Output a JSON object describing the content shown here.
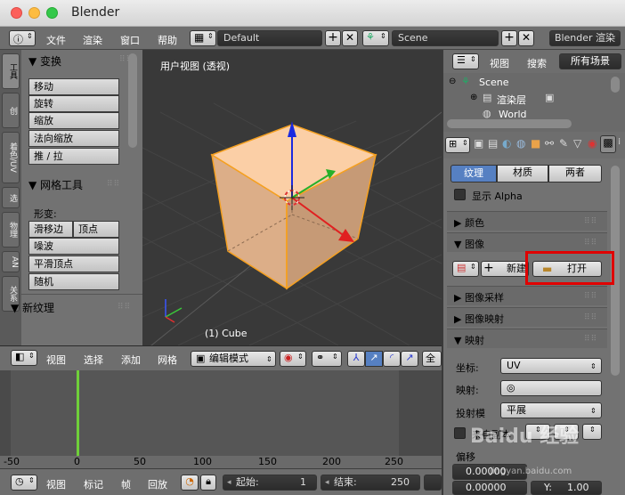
{
  "window": {
    "title": "Blender"
  },
  "topbar": {
    "menus": [
      "文件",
      "渲染",
      "窗口",
      "帮助"
    ],
    "screen_layout": "Default",
    "scene": "Scene",
    "render_engine": "Blender 渲染"
  },
  "left_tabs": [
    "工具",
    "创",
    "着色/UV",
    "选",
    "物理",
    "AN",
    "关系"
  ],
  "toolshelf": {
    "transform_title": "▼ 变换",
    "transform_items": [
      "移动",
      "旋转",
      "缩放",
      "法向缩放",
      "推 / 拉"
    ],
    "mesh_tools_title": "▼ 网格工具",
    "deform_label": "形变:",
    "slide_edge": "滑移边",
    "vertex": "顶点",
    "mesh_items": [
      "噪波",
      "平滑顶点",
      "随机"
    ],
    "new_texture_title": "▼ 新纹理"
  },
  "viewport": {
    "label": "用户视图 (透视)",
    "object_label": "(1) Cube"
  },
  "viewport_header": {
    "menus": [
      "视图",
      "选择",
      "添加",
      "网格"
    ],
    "mode": "编辑模式",
    "global": "全局"
  },
  "timeline": {
    "ruler_labels": [
      "-50",
      "0",
      "50",
      "100",
      "150",
      "200",
      "250"
    ]
  },
  "bottombar": {
    "menus": [
      "视图",
      "标记",
      "帧",
      "回放"
    ],
    "start_label": "起始:",
    "start_value": "1",
    "end_label": "结束:",
    "end_value": "250"
  },
  "outliner_header": {
    "view": "视图",
    "search": "搜索",
    "scope": "所有场景"
  },
  "outliner": {
    "items": [
      "Scene",
      "渲染层",
      "World"
    ]
  },
  "texture_props": {
    "tabs": [
      "纹理",
      "材质",
      "两者"
    ],
    "show_alpha": "显示 Alpha",
    "panel_color": "▶ 颜色",
    "panel_image": "▼ 图像",
    "new_label": "新建",
    "open_label": "打开",
    "panel_sampling": "▶ 图像采样",
    "panel_mapping": "▶ 图像映射",
    "panel_map": "▼ 映射",
    "coords_label": "坐标:",
    "coords_value": "UV",
    "map_label": "映射:",
    "projection_label": "投射模",
    "projection_value": "平展",
    "from_dupli": "来自副本",
    "offset_label": "偏移",
    "offset_x": "0.00000",
    "offset_y": "0.00000",
    "scale_y_label": "Y:",
    "scale_y": "1.00"
  },
  "watermark": "Baidu 经验",
  "watermark_url": "jingyan.baidu.com",
  "colors": {
    "highlight": "#e00000",
    "selected_tab": "#5680c2",
    "edit_orange": "#f5a020"
  }
}
